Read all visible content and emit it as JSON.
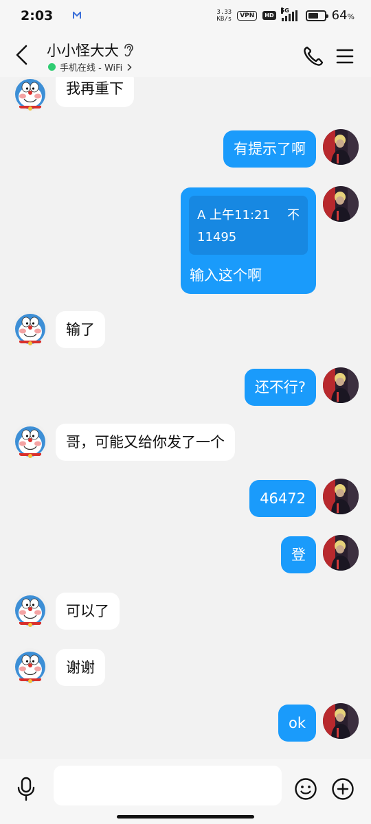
{
  "status_bar": {
    "time": "2:03",
    "net_speed_value": "3.33",
    "net_speed_unit": "KB/s",
    "vpn_label": "VPN",
    "hd_label": "HD",
    "network_label": "5G",
    "battery_percent_value": "64",
    "battery_percent_sign": "%",
    "battery_level": 0.64
  },
  "header": {
    "contact_name": "小小怪大大",
    "status_text": "手机在线 - WiFi",
    "status_color": "#2ecc71"
  },
  "colors": {
    "outgoing_bubble": "#1a9bfb",
    "incoming_bubble": "#ffffff",
    "background": "#f2f2f2"
  },
  "messages": [
    {
      "side": "in",
      "text": "我再重下"
    },
    {
      "side": "out",
      "text": "有提示了啊"
    },
    {
      "side": "out",
      "type": "quote",
      "quote_line1": "A 上午11:21",
      "quote_line1_right": "不",
      "quote_line2": "11495",
      "text": "输入这个啊"
    },
    {
      "side": "in",
      "text": "输了"
    },
    {
      "side": "out",
      "text": "还不行?"
    },
    {
      "side": "in",
      "text": "哥，可能又给你发了一个"
    },
    {
      "side": "out",
      "text": "46472"
    },
    {
      "side": "out",
      "text": "登"
    },
    {
      "side": "in",
      "text": "可以了"
    },
    {
      "side": "in",
      "text": "谢谢"
    },
    {
      "side": "out",
      "text": "ok"
    }
  ],
  "input_bar": {
    "placeholder": "",
    "icons": [
      "microphone-icon",
      "emoji-icon",
      "plus-icon"
    ]
  }
}
